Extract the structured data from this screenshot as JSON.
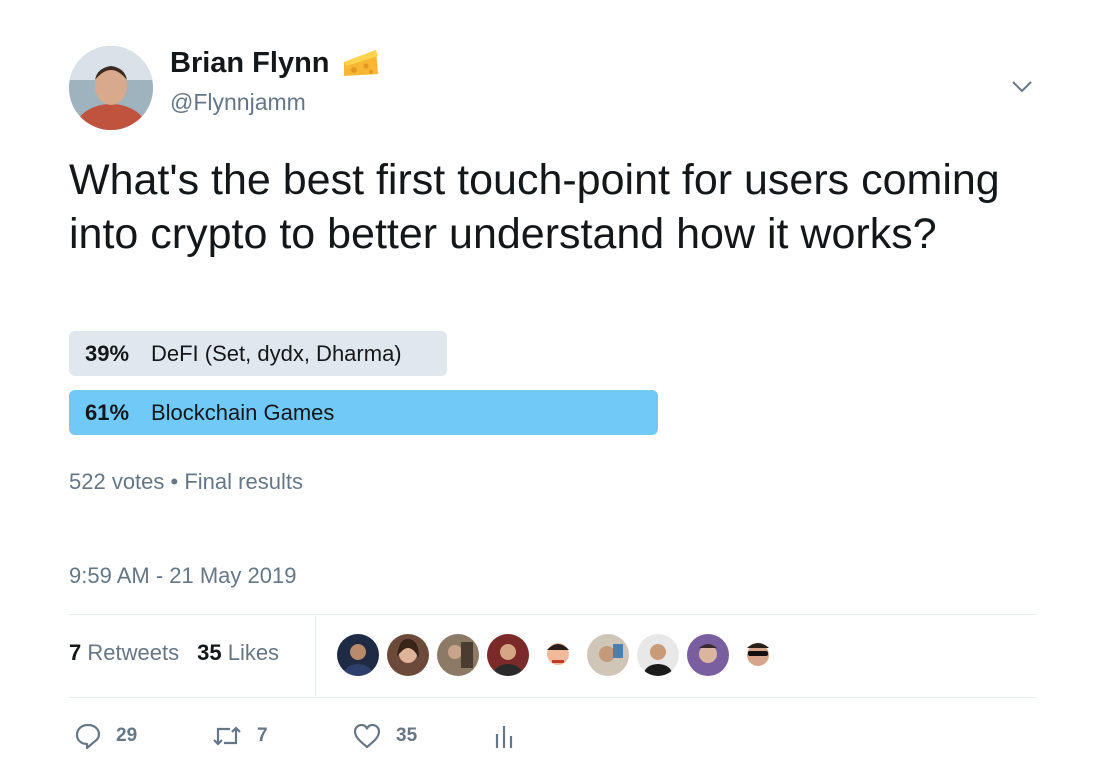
{
  "author": {
    "name": "Brian Flynn",
    "handle": "@Flynnjamm",
    "emoji": "cheese-icon"
  },
  "tweet": {
    "text": "What's the best first touch-point for users coming into crypto to better understand how it works?"
  },
  "poll": {
    "options": [
      {
        "percent": "39%",
        "label": "DeFI (Set, dydx, Dharma)",
        "share": 0.39,
        "color": "#e1e8ed"
      },
      {
        "percent": "61%",
        "label": "Blockchain Games",
        "share": 0.61,
        "color": "#71c9f8"
      }
    ],
    "votes": "522 votes",
    "status": "Final results",
    "separator": "•"
  },
  "timestamp": "9:59 AM - 21 May 2019",
  "stats": {
    "retweets_count": "7",
    "retweets_label": "Retweets",
    "likes_count": "35",
    "likes_label": "Likes"
  },
  "actions": {
    "replies": "29",
    "retweets": "7",
    "likes": "35"
  },
  "colors": {
    "text": "#14171a",
    "muted": "#657786",
    "accent": "#71c9f8",
    "divider": "#e6ecf0"
  }
}
